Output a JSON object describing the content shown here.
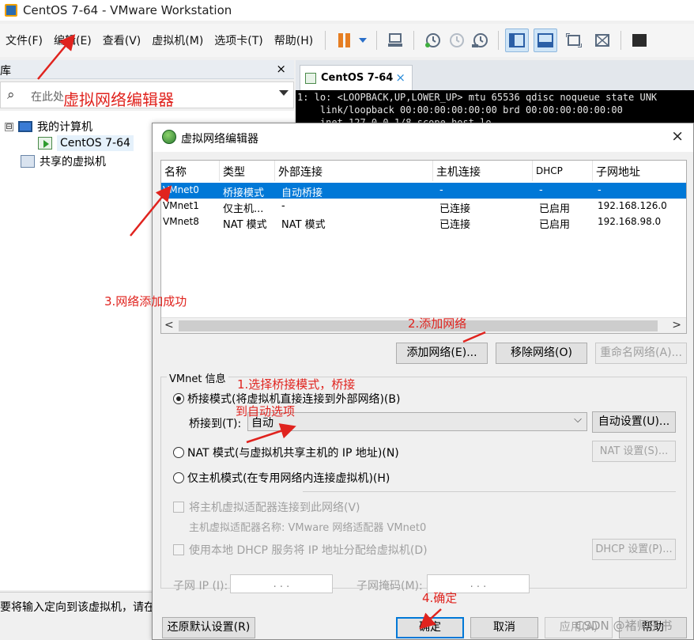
{
  "window": {
    "title": "CentOS 7-64 - VMware Workstation"
  },
  "menubar": {
    "items": [
      "文件(F)",
      "编辑(E)",
      "查看(V)",
      "虚拟机(M)",
      "选项卡(T)",
      "帮助(H)"
    ]
  },
  "toolbar": {
    "icons": [
      "pause-icon",
      "dropdown-icon",
      "send-ctrl-alt-del-icon",
      "snapshot-icon",
      "revert-snapshot-icon",
      "snapshot-manager-icon",
      "library-view-icon",
      "thumbnail-view-icon",
      "fullscreen-icon",
      "unity-icon",
      "console-view-icon"
    ]
  },
  "library": {
    "title": "库",
    "close": "×",
    "search_placeholder": "在此处",
    "tree": {
      "expander": "⊟",
      "root": "我的计算机",
      "vm": "CentOS 7-64",
      "shared": "共享的虚拟机"
    }
  },
  "statusbar": {
    "text": "要将输入定向到该虚拟机，请在"
  },
  "vm_tab": {
    "label": "CentOS 7-64",
    "close": "×"
  },
  "terminal": {
    "lines": [
      "1: lo: <LOOPBACK,UP,LOWER_UP> mtu 65536 qdisc noqueue state UNK",
      "    link/loopback 00:00:00:00:00:00 brd 00:00:00:00:00:00",
      "    inet 127.0.0.1/8 scope host lo"
    ]
  },
  "dialog": {
    "title": "虚拟网络编辑器",
    "close": "×",
    "table": {
      "columns": [
        "名称",
        "类型",
        "外部连接",
        "主机连接",
        "DHCP",
        "子网地址"
      ],
      "rows": [
        [
          "VMnet0",
          "桥接模式",
          "自动桥接",
          "-",
          "-",
          "-"
        ],
        [
          "VMnet1",
          "仅主机...",
          "-",
          "已连接",
          "已启用",
          "192.168.126.0"
        ],
        [
          "VMnet8",
          "NAT 模式",
          "NAT 模式",
          "已连接",
          "已启用",
          "192.168.98.0"
        ]
      ],
      "scroll_left": "<",
      "scroll_right": ">"
    },
    "buttons": {
      "add": "添加网络(E)...",
      "remove": "移除网络(O)",
      "rename": "重命名网络(A)..."
    },
    "vmnet_info": {
      "group_title": "VMnet 信息",
      "bridge_radio": "桥接模式(将虚拟机直接连接到外部网络)(B)",
      "bridge_to_label": "桥接到(T):",
      "bridge_to_value": "自动",
      "select_arrow": "⌵",
      "auto_settings": "自动设置(U)...",
      "nat_radio": "NAT 模式(与虚拟机共享主机的 IP 地址)(N)",
      "nat_settings": "NAT 设置(S)...",
      "hostonly_radio": "仅主机模式(在专用网络内连接虚拟机)(H)",
      "connect_adapter": "将主机虚拟适配器连接到此网络(V)",
      "adapter_name": "主机虚拟适配器名称: VMware 网络适配器 VMnet0",
      "dhcp_check": "使用本地 DHCP 服务将 IP 地址分配给虚拟机(D)",
      "dhcp_settings": "DHCP 设置(P)...",
      "subnet_ip_label": "子网 IP (I):",
      "subnet_mask_label": "子网掩码(M):",
      "ip_dots": ". . ."
    },
    "footer": {
      "restore": "还原默认设置(R)",
      "ok": "确定",
      "cancel": "取消",
      "apply": "应用(A)",
      "help": "帮助"
    }
  },
  "annotations": {
    "title_note": "虚拟网络编辑器",
    "step1_line1": "1.选择桥接模式，桥接",
    "step1_line2": "到自动选项",
    "step2": "2.添加网络",
    "step3": "3.网络添加成功",
    "step4": "4.确定",
    "color": "#e0231e"
  },
  "watermark": "CSDN @褚师子书"
}
